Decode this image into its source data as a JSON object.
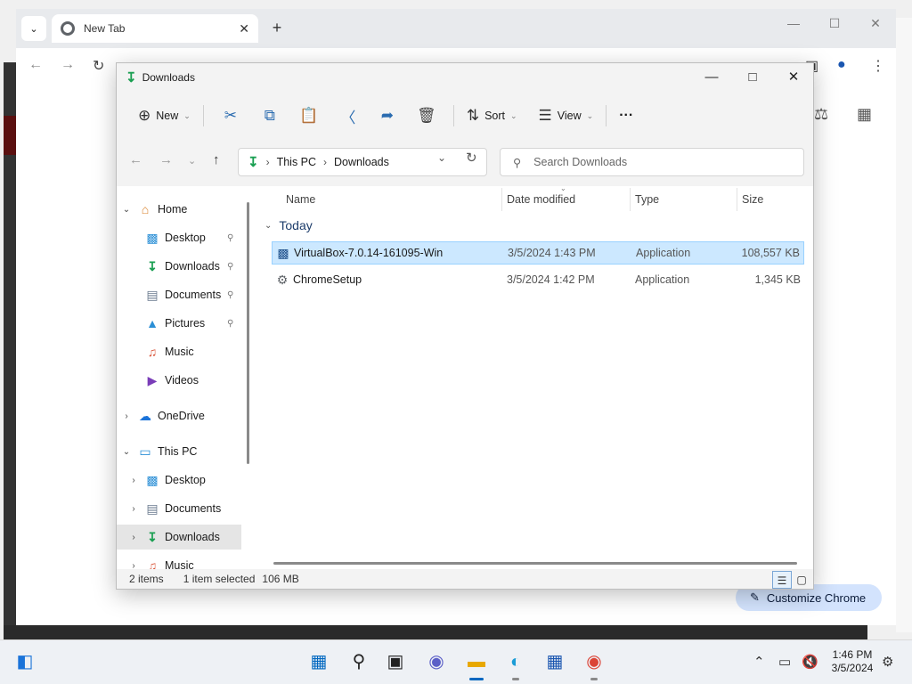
{
  "chrome": {
    "tab_title": "New Tab",
    "new_tab": "+",
    "customize_label": "Customize Chrome"
  },
  "explorer": {
    "title": "Downloads",
    "commands": {
      "new_label": "New",
      "sort_label": "Sort",
      "view_label": "View",
      "more": "···"
    },
    "address": {
      "segments": [
        "This PC",
        "Downloads"
      ]
    },
    "search": {
      "placeholder": "Search Downloads"
    },
    "nav": {
      "home": "Home",
      "quick_access": [
        {
          "label": "Desktop"
        },
        {
          "label": "Downloads"
        },
        {
          "label": "Documents"
        },
        {
          "label": "Pictures"
        },
        {
          "label": "Music"
        },
        {
          "label": "Videos"
        }
      ],
      "onedrive": "OneDrive",
      "this_pc": "This PC",
      "this_pc_items": [
        {
          "label": "Desktop"
        },
        {
          "label": "Documents"
        },
        {
          "label": "Downloads"
        },
        {
          "label": "Music"
        }
      ]
    },
    "columns": {
      "name": "Name",
      "date": "Date modified",
      "type": "Type",
      "size": "Size"
    },
    "group_label": "Today",
    "files": [
      {
        "name": "VirtualBox-7.0.14-161095-Win",
        "date": "3/5/2024 1:43 PM",
        "type": "Application",
        "size": "108,557 KB",
        "selected": true
      },
      {
        "name": "ChromeSetup",
        "date": "3/5/2024 1:42 PM",
        "type": "Application",
        "size": "1,345 KB",
        "selected": false
      }
    ],
    "status": {
      "count": "2 items",
      "selected": "1 item selected",
      "size": "106 MB"
    }
  },
  "taskbar": {
    "time": "1:46 PM",
    "date": "3/5/2024"
  },
  "colors": {
    "selection": "#cce8ff",
    "accent": "#0067c0",
    "download_green": "#1a9f52"
  }
}
